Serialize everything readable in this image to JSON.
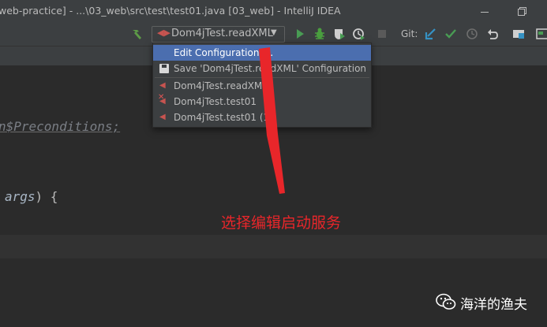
{
  "window": {
    "title": "web-practice] - ...\\03_web\\src\\test\\test01.java [03_web] - IntelliJ IDEA"
  },
  "toolbar": {
    "run_config": "Dom4jTest.readXML",
    "git_label": "Git:",
    "icons": [
      "hammer-icon",
      "run-icon",
      "debug-icon",
      "coverage-icon",
      "profile-icon",
      "stop-icon",
      "git-update-icon",
      "git-commit-icon",
      "history-icon",
      "revert-icon",
      "project-structure-icon",
      "terminal-icon"
    ]
  },
  "dropdown": {
    "items": [
      {
        "label": "Edit Configurations...",
        "selected": true
      },
      {
        "label": "Save 'Dom4jTest.readXML' Configuration",
        "icon": "save-icon"
      },
      {
        "label": "Dom4jTest.readXML",
        "icon": "junit-icon"
      },
      {
        "label": "Dom4jTest.test01",
        "icon": "junit-error-icon"
      },
      {
        "label": "Dom4jTest.test01 (1)",
        "icon": "junit-icon"
      }
    ]
  },
  "editor": {
    "import_line": "n$Preconditions;",
    "args_word": "args",
    "args_tail": ") {"
  },
  "annotation": {
    "text": "选择编辑启动服务",
    "color": "#e8262a"
  },
  "watermark": {
    "text": "海洋的渔夫"
  },
  "colors": {
    "selection": "#4b6eaf",
    "run_green": "#499c54",
    "debug_green": "#4a9e3f",
    "git_blue": "#3592c4"
  }
}
